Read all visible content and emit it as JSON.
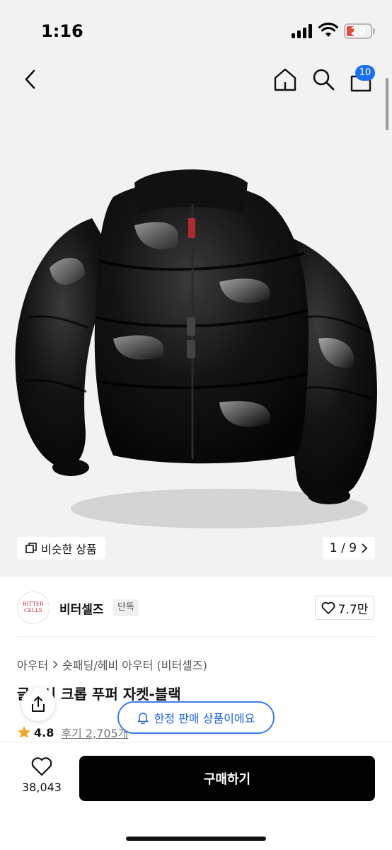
{
  "status_bar": {
    "time": "1:16",
    "battery": "20"
  },
  "nav": {
    "cart_count": "10"
  },
  "gallery": {
    "similar_label": "비슷한 상품",
    "pager": "1 / 9"
  },
  "brand": {
    "logo_line1": "BITTER",
    "logo_line2": "CELLS",
    "name": "비터셀즈",
    "tag": "단독",
    "likes": "7.7만"
  },
  "breadcrumb": {
    "category": "아우터",
    "subcategory": "숏패딩/헤비 아우터 (비터셀즈)"
  },
  "product": {
    "title": "글로시 크롭 푸퍼 자켓-블랙",
    "rating": "4.8",
    "reviews": "후기 2,705개"
  },
  "toast": {
    "label": "한정 판매 상품이에요"
  },
  "bottom": {
    "wish_count": "38,043",
    "buy_label": "구매하기"
  },
  "colors": {
    "accent": "#1a6ff5",
    "pill_border": "#3b7cf0",
    "buy_bg": "#000000",
    "star": "#f5a623",
    "brand_red": "#b12a30"
  }
}
